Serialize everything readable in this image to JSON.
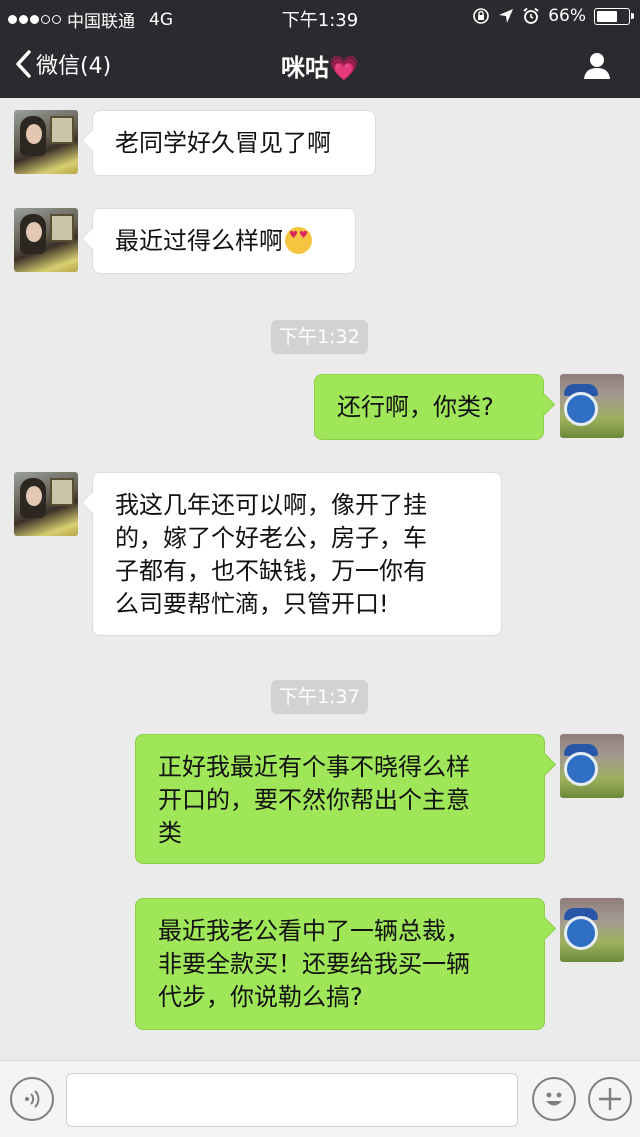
{
  "status_bar": {
    "carrier": "中国联通",
    "network": "4G",
    "time": "下午1:39",
    "battery_percent": "66%",
    "battery_level": 0.66
  },
  "nav": {
    "back_label": "微信(4)",
    "title": "咪咕💗"
  },
  "messages": [
    {
      "from": "peer",
      "text": "老同学好久冒见了啊"
    },
    {
      "from": "peer",
      "text": "最近过得么样啊",
      "emoji": "heart-eyes-emoji"
    },
    {
      "type": "time",
      "text": "下午1:32"
    },
    {
      "from": "me",
      "text": "还行啊，你类?"
    },
    {
      "from": "peer",
      "lines": [
        "我这几年还可以啊，像开了挂",
        "的，嫁了个好老公，房子，车",
        "子都有，也不缺钱，万一你有",
        "么司要帮忙滴，只管开口!"
      ]
    },
    {
      "type": "time",
      "text": "下午1:37"
    },
    {
      "from": "me",
      "lines": [
        "正好我最近有个事不晓得么样",
        "开口的，要不然你帮出个主意",
        "类"
      ]
    },
    {
      "from": "me",
      "lines": [
        "最近我老公看中了一辆总裁，",
        "非要全款买！还要给我买一辆",
        "代步，你说勒么搞?"
      ]
    }
  ],
  "colors": {
    "nav_bg": "#2b2b2f",
    "chat_bg": "#ebebeb",
    "my_bubble": "#9fe658",
    "peer_bubble": "#ffffff",
    "time_badge": "#d2d2d2"
  },
  "icons": {
    "back": "chevron-left-icon",
    "profile": "person-icon",
    "voice": "voice-icon",
    "emoji": "smiley-icon",
    "more": "plus-icon"
  }
}
